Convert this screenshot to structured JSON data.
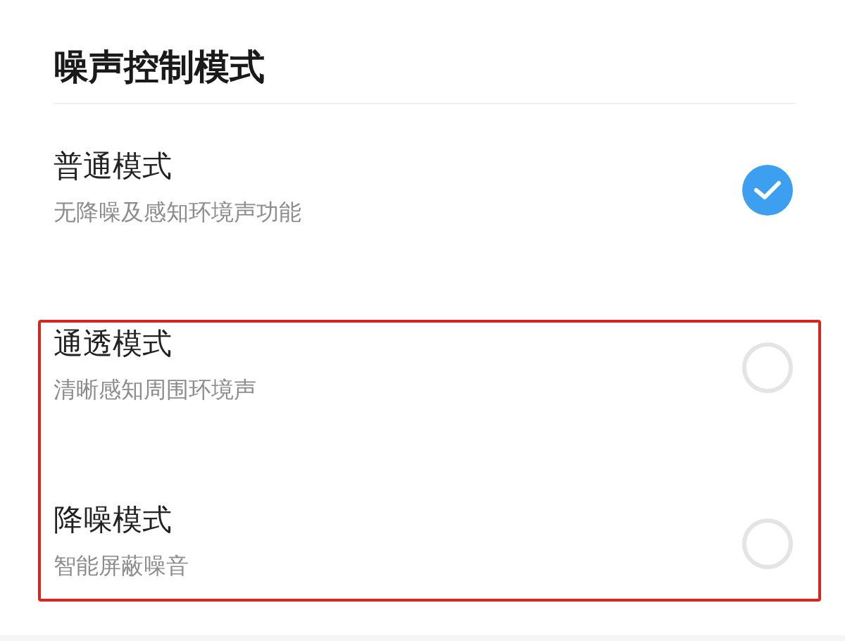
{
  "section": {
    "title": "噪声控制模式"
  },
  "modes": [
    {
      "label": "普通模式",
      "description": "无降噪及感知环境声功能",
      "selected": true,
      "highlighted": false
    },
    {
      "label": "通透模式",
      "description": "清晰感知周围环境声",
      "selected": false,
      "highlighted": true
    },
    {
      "label": "降噪模式",
      "description": "智能屏蔽噪音",
      "selected": false,
      "highlighted": true
    }
  ]
}
